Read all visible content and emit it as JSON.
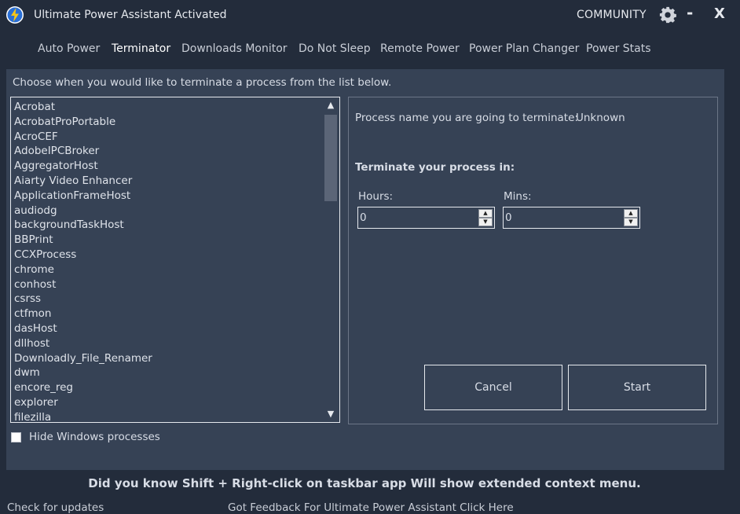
{
  "window": {
    "title": "Ultimate Power Assistant Activated",
    "community_label": "COMMUNITY",
    "minimize_label": "-",
    "close_label": "X",
    "app_icon": "lightning-bolt-icon",
    "settings_icon": "gear-icon"
  },
  "tabs": [
    {
      "label": "Auto Power",
      "active": false
    },
    {
      "label": "Terminator",
      "active": true
    },
    {
      "label": "Downloads Monitor",
      "active": false
    },
    {
      "label": "Do Not Sleep",
      "active": false
    },
    {
      "label": "Remote Power",
      "active": false
    },
    {
      "label": "Power Plan Changer",
      "active": false
    },
    {
      "label": "Power Stats",
      "active": false
    }
  ],
  "terminator": {
    "instruction": "Choose when you would like to terminate a process from the list below.",
    "processes": [
      "Acrobat",
      "AcrobatProPortable",
      "AcroCEF",
      "AdobeIPCBroker",
      "AggregatorHost",
      "Aiarty Video Enhancer",
      "ApplicationFrameHost",
      "audiodg",
      "backgroundTaskHost",
      "BBPrint",
      "CCXProcess",
      "chrome",
      "conhost",
      "csrss",
      "ctfmon",
      "dasHost",
      "dllhost",
      "Downloadly_File_Renamer",
      "dwm",
      "encore_reg",
      "explorer",
      "filezilla"
    ],
    "scroll_up": "▲",
    "scroll_down": "▼",
    "hide_windows_label": "Hide Windows processes",
    "hide_windows_checked": false,
    "process_name_label": "Process name you are going to terminate:",
    "process_name_value": "Unknown",
    "terminate_in_label": "Terminate your process in:",
    "hours_label": "Hours:",
    "hours_value": "0",
    "mins_label": "Mins:",
    "mins_value": "0",
    "cancel_label": "Cancel",
    "start_label": "Start"
  },
  "footer": {
    "tip": "Did you know Shift + Right-click on taskbar app Will show extended context menu.",
    "check_updates": "Check for updates",
    "feedback": "Got Feedback For Ultimate Power Assistant Click Here"
  },
  "colors": {
    "background": "#232c3b",
    "panel": "#364255",
    "accent_bolt": "#f5c518",
    "accent_circle": "#2a6fd6"
  }
}
